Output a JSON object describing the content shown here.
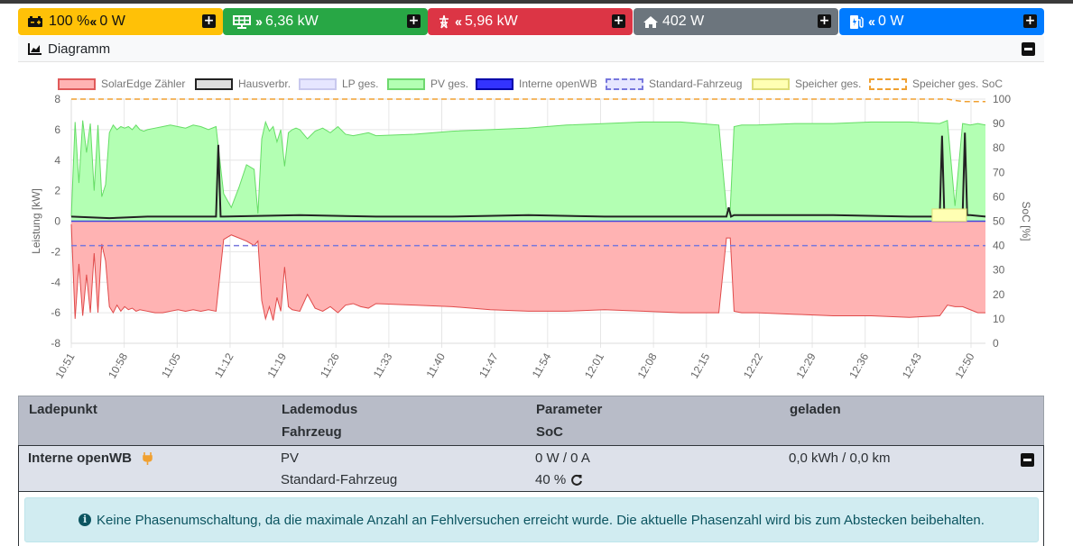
{
  "status_bar": {
    "battery": {
      "value": "100 % ",
      "power": "0 W"
    },
    "pv": {
      "power": "6,36 kW"
    },
    "grid": {
      "power": "5,96 kW"
    },
    "house": {
      "power": "402 W"
    },
    "charger": {
      "power": "0 W"
    },
    "icons": [
      "battery-icon",
      "solar-panel-icon",
      "power-tower-icon",
      "house-icon",
      "charging-station-icon"
    ],
    "colors": {
      "yellow": "#ffc107",
      "green": "#28a745",
      "red": "#dc3545",
      "grey": "#6c757d",
      "blue": "#007bff"
    }
  },
  "chart_card": {
    "title": "Diagramm"
  },
  "chart_data": {
    "type": "area",
    "legend": [
      {
        "name": "SolarEdge Zähler",
        "color": "#ffb3b3",
        "border": "#e05a5a",
        "style": "solid"
      },
      {
        "name": "Hausverbr.",
        "color": "#dddddd",
        "border": "#222222",
        "style": "solid"
      },
      {
        "name": "LP ges.",
        "color": "#e6e6ff",
        "border": "#c8c8ee",
        "style": "solid"
      },
      {
        "name": "PV ges.",
        "color": "#b3ffb3",
        "border": "#6ed86e",
        "style": "solid"
      },
      {
        "name": "Interne openWB",
        "color": "#3333ff",
        "border": "#0000aa",
        "style": "solid"
      },
      {
        "name": "Standard-Fahrzeug",
        "color": "#e6e6ff",
        "border": "#7777dd",
        "style": "dashed"
      },
      {
        "name": "Speicher ges.",
        "color": "#ffffb3",
        "border": "#dddd77",
        "style": "solid"
      },
      {
        "name": "Speicher ges. SoC",
        "color": "#ffffff",
        "border": "#f0a030",
        "style": "dashed"
      }
    ],
    "ylabel": "Leistung [kW]",
    "ylabel_right": "SoC [%]",
    "ylim": [
      -8,
      8
    ],
    "yticks": [
      "8",
      "6",
      "4",
      "2",
      "0",
      "-2",
      "-4",
      "-6",
      "-8"
    ],
    "ylim_right": [
      0,
      100
    ],
    "yticks_right": [
      "100",
      "90",
      "80",
      "70",
      "60",
      "50",
      "40",
      "30",
      "20",
      "10",
      "0"
    ],
    "xticks": [
      "10:51",
      "10:58",
      "11:05",
      "11:12",
      "11:19",
      "11:26",
      "11:33",
      "11:40",
      "11:47",
      "11:54",
      "12:01",
      "12:08",
      "12:15",
      "12:22",
      "12:29",
      "12:36",
      "12:43",
      "12:50"
    ],
    "grid": true,
    "time_start_min": 0,
    "time_end_min": 120,
    "series": [
      {
        "name": "PV ges.",
        "x": [
          0,
          0.5,
          1,
          1.5,
          2,
          2.5,
          3,
          3.5,
          4,
          4.5,
          5,
          5.5,
          6,
          6.5,
          7,
          7.5,
          8,
          8.5,
          9,
          9.5,
          10,
          11,
          12,
          13,
          14,
          15,
          16,
          17,
          18,
          19,
          20,
          21,
          22,
          23,
          24,
          24.5,
          25,
          25.5,
          26,
          26.5,
          27,
          27.5,
          28,
          28.5,
          29,
          29.5,
          30,
          31,
          32,
          33,
          34,
          35,
          36,
          37,
          38,
          39,
          40,
          45,
          50,
          55,
          60,
          65,
          70,
          75,
          80,
          85,
          86,
          86.5,
          87,
          88,
          90,
          95,
          100,
          105,
          110,
          114,
          115,
          116,
          117,
          118,
          119,
          120
        ],
        "values": [
          0.3,
          6.5,
          2.5,
          6.6,
          4.5,
          6.4,
          2.0,
          6.3,
          1.6,
          2.4,
          5.8,
          6.3,
          6.0,
          6.2,
          6.1,
          6.2,
          6.0,
          6.3,
          6.0,
          5.9,
          6.0,
          6.1,
          6.2,
          6.3,
          6.2,
          6.1,
          6.3,
          6.2,
          6.0,
          6.2,
          1.8,
          0.9,
          2.2,
          3.7,
          3.4,
          0.5,
          5.4,
          6.5,
          5.9,
          6.2,
          5.2,
          6.0,
          3.6,
          5.8,
          6.0,
          6.1,
          6.0,
          5.4,
          5.9,
          6.1,
          5.8,
          6.2,
          5.7,
          5.6,
          5.7,
          5.8,
          5.6,
          5.7,
          5.9,
          6.0,
          6.1,
          6.3,
          6.4,
          6.5,
          6.5,
          6.3,
          0.8,
          0.8,
          6.2,
          6.3,
          6.3,
          6.4,
          6.4,
          6.5,
          6.5,
          6.4,
          6.6,
          1.0,
          6.4,
          6.3,
          6.4,
          6.3
        ]
      },
      {
        "name": "SolarEdge Zähler",
        "x": [
          0,
          0.5,
          1,
          1.5,
          2,
          2.5,
          3,
          3.5,
          4,
          4.5,
          5,
          5.5,
          6,
          6.5,
          7,
          7.5,
          8,
          8.5,
          9,
          10,
          11,
          12,
          13,
          14,
          15,
          16,
          17,
          18,
          19,
          20,
          21,
          22,
          23,
          24,
          24.5,
          25,
          25.5,
          26,
          26.5,
          27,
          27.5,
          28,
          28.5,
          29,
          30,
          31,
          32,
          33,
          34,
          35,
          36,
          37,
          38,
          39,
          40,
          45,
          50,
          55,
          60,
          65,
          70,
          75,
          80,
          85,
          86,
          86.5,
          87,
          88,
          90,
          95,
          100,
          105,
          110,
          114,
          115,
          116,
          117,
          118,
          119,
          120
        ],
        "values": [
          -0.2,
          -6.4,
          -2.8,
          -6.2,
          -3.5,
          -6.0,
          -2.1,
          -6.0,
          -1.5,
          -2.6,
          -5.6,
          -6.0,
          -5.5,
          -5.9,
          -5.6,
          -5.8,
          -5.7,
          -5.9,
          -5.8,
          -5.9,
          -6.0,
          -6.0,
          -5.9,
          -5.8,
          -5.9,
          -5.8,
          -5.9,
          -5.8,
          -5.9,
          -1.2,
          -0.9,
          -1.1,
          -1.3,
          -1.6,
          -1.3,
          -5.2,
          -6.4,
          -5.6,
          -6.5,
          -5.0,
          -5.9,
          -3.0,
          -5.6,
          -5.8,
          -5.9,
          -4.8,
          -5.7,
          -5.9,
          -5.6,
          -6.0,
          -5.5,
          -5.4,
          -5.6,
          -5.7,
          -5.4,
          -5.5,
          -5.6,
          -5.8,
          -5.9,
          -5.9,
          -5.8,
          -5.9,
          -6.0,
          -6.0,
          -1.1,
          -1.1,
          -5.9,
          -6.0,
          -6.0,
          -6.1,
          -6.2,
          -6.2,
          -6.3,
          -6.2,
          -5.5,
          -5.6,
          -5.6,
          -5.8,
          -6.0,
          -6.0
        ]
      },
      {
        "name": "Hausverbr.",
        "x": [
          0,
          5,
          10,
          15,
          19,
          19.3,
          19.6,
          20,
          30,
          40,
          50,
          60,
          70,
          80,
          85,
          86,
          86.3,
          86.6,
          87,
          100,
          110,
          113,
          114,
          114.3,
          114.6,
          115,
          116,
          117,
          117.3,
          117.6,
          118,
          120
        ],
        "values": [
          0.3,
          0.2,
          0.3,
          0.3,
          0.3,
          5.0,
          0.3,
          0.3,
          0.4,
          0.3,
          0.3,
          0.4,
          0.3,
          0.3,
          0.3,
          0.3,
          0.9,
          0.3,
          0.4,
          0.4,
          0.3,
          0.3,
          0.4,
          5.6,
          0.4,
          0.4,
          0.4,
          0.4,
          5.8,
          0.4,
          0.4,
          0.3
        ]
      },
      {
        "name": "Standard-Fahrzeug",
        "x": [
          0,
          120
        ],
        "values": [
          40,
          40
        ],
        "axis": "right"
      },
      {
        "name": "Speicher ges. SoC",
        "x": [
          0,
          115,
          117,
          120
        ],
        "values": [
          100,
          100,
          99,
          99
        ],
        "axis": "right"
      }
    ]
  },
  "table": {
    "headers": {
      "col1": "Ladepunkt",
      "col2_line1": "Lademodus",
      "col2_line2": "Fahrzeug",
      "col3_line1": "Parameter",
      "col3_line2": "SoC",
      "col4": "geladen"
    },
    "row": {
      "name": "Interne openWB",
      "mode": "PV",
      "vehicle": "Standard-Fahrzeug",
      "parameter": "0 W / 0 A",
      "soc": "40 %",
      "charged": "0,0 kWh / 0,0 km"
    },
    "alert": "Keine Phasenumschaltung, da die maximale Anzahl an Fehlversuchen erreicht wurde. Die aktuelle Phasenzahl wird bis zum Abstecken beibehalten."
  }
}
